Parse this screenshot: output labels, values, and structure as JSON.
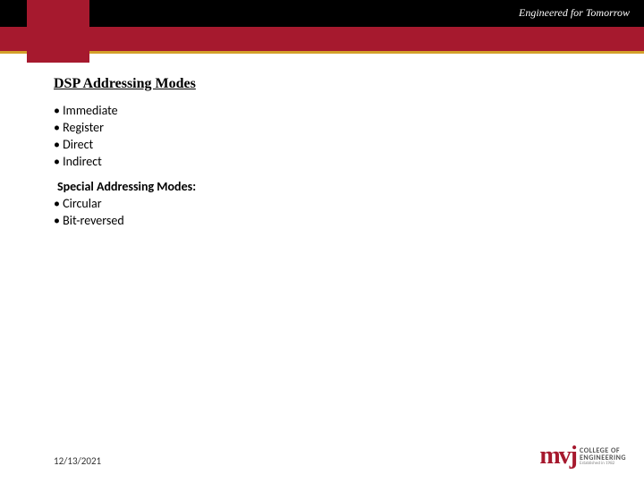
{
  "header": {
    "tagline": "Engineered for Tomorrow"
  },
  "slide": {
    "title": "DSP Addressing Modes",
    "bullets1": {
      "b0": "Immediate",
      "b1": "Register",
      "b2": "Direct",
      "b3": "Indirect"
    },
    "subheading": "Special Addressing Modes:",
    "bullets2": {
      "b0": "Circular",
      "b1": "Bit-reversed"
    }
  },
  "footer": {
    "date": "12/13/2021",
    "logo": {
      "mark": "mvj",
      "line1": "COLLEGE OF",
      "line2": "ENGINEERING",
      "sub": "Established in 1982"
    }
  }
}
